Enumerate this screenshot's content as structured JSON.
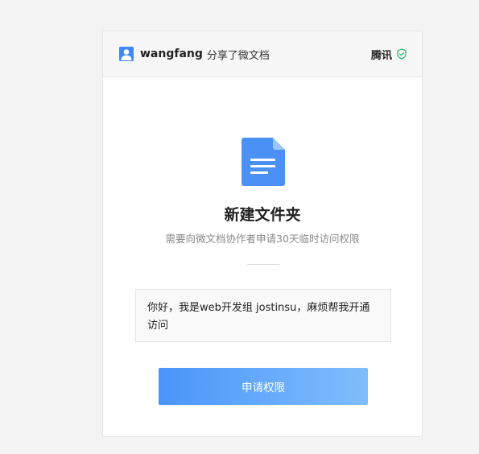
{
  "header": {
    "username": "wangfang",
    "share_text": "分享了微文档",
    "brand": "腾讯"
  },
  "document": {
    "title": "新建文件夹",
    "subtitle": "需要向微文档协作者申请30天临时访问权限"
  },
  "request": {
    "message": "你好，我是web开发组 jostinsu，麻烦帮我开通访问"
  },
  "actions": {
    "apply_label": "申请权限"
  },
  "colors": {
    "accent": "#3d8af7",
    "verified": "#2fbf71",
    "doc_icon": "#4a90f5"
  }
}
